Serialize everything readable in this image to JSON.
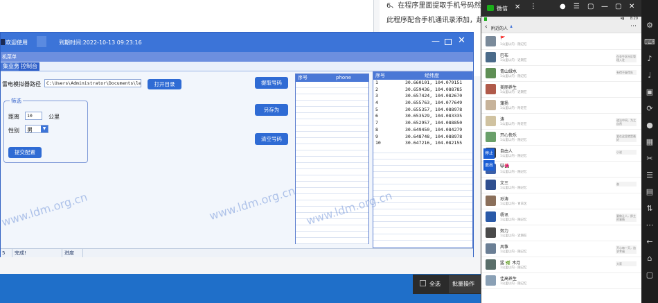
{
  "doc": {
    "line1": "6、在程序里面提取手机号码然后保存",
    "line2": "此程序配合手机通讯录添加，超"
  },
  "taskbar": {
    "select_all": "全选",
    "batch": "批量操作"
  },
  "app": {
    "title": "欢迎使用",
    "expire": "到期时间:2022-10-13 09:23:16",
    "menu": "机菜单",
    "tabs": [
      "集业务",
      "控制台"
    ],
    "path_label": "雷电模拟器路径",
    "path_value": "C:\\Users\\Administrator\\Documents\\leidi",
    "open_dir": "打开目录",
    "filter": {
      "legend": "筛选",
      "distance_label": "距离",
      "distance_value": "10",
      "distance_unit": "公里",
      "gender_label": "性别",
      "gender_value": "男",
      "submit": "提交配置"
    },
    "actions": {
      "extract": "提取号码",
      "save_as": "另存为",
      "clear": "清空号码"
    },
    "phone_grid": {
      "col_index": "序号",
      "col_phone": "phone"
    },
    "coord_grid": {
      "col_index": "序号",
      "col_coord": "经纬度",
      "rows": [
        {
          "n": "1",
          "v": "30.660101, 104.079151"
        },
        {
          "n": "2",
          "v": "30.659436, 104.088785"
        },
        {
          "n": "3",
          "v": "30.657424, 104.082670"
        },
        {
          "n": "4",
          "v": "30.655763, 104.077649"
        },
        {
          "n": "5",
          "v": "30.655357, 104.088978"
        },
        {
          "n": "6",
          "v": "30.653529, 104.083335"
        },
        {
          "n": "7",
          "v": "30.652957, 104.088850"
        },
        {
          "n": "8",
          "v": "30.649450, 104.084279"
        },
        {
          "n": "9",
          "v": "30.648748, 104.088978"
        },
        {
          "n": "10",
          "v": "30.647216, 104.082155"
        }
      ]
    },
    "status": {
      "left": "5",
      "done": "完成!",
      "progress": "进度"
    }
  },
  "watermarks": [
    "www.ldm.org.cn",
    "www.ldm.org.cn",
    "www.ldm.org.cn"
  ],
  "phone": {
    "app_name": "微信",
    "page_title": "附近的人",
    "time": "8:29",
    "stop": "停止",
    "quit": "退出",
    "people": [
      {
        "name": "🚩",
        "dist": "1公里以内 · 随记忆",
        "sig": "",
        "color": "#7a8a9a"
      },
      {
        "name": "巴布",
        "dist": "1公里以内 · 近期在",
        "sig": "在金牛区社区管理入驻",
        "color": "#4b6b8a"
      },
      {
        "name": "青山绿水",
        "dist": "1公里以内 · 随记忆",
        "sig": "有得不复得失",
        "color": "#5f8f55"
      },
      {
        "name": "美丽养生",
        "dist": "1公里以内 · 近期在",
        "sig": "",
        "color": "#b05a4a"
      },
      {
        "name": "蒲扬",
        "dist": "1公里以内 · 附近在",
        "sig": "",
        "color": "#c7b39a"
      },
      {
        "name": "涛",
        "dist": "1公里以内 · 附近在",
        "sig": "道法中间，为之自然",
        "color": "#d0c2a0"
      },
      {
        "name": "开心快乐",
        "dist": "1公里以内 · 随记忆",
        "sig": "爱在这里就是最好",
        "color": "#6aa06a"
      },
      {
        "name": "自由人",
        "dist": "1公里以内 · 随记忆",
        "sig": "小说",
        "color": "#3a3a3a"
      },
      {
        "name": "😺🌺",
        "dist": "1公里以内 · 随记忆",
        "sig": "",
        "color": "#3b5fa8"
      },
      {
        "name": "文三",
        "dist": "1公里以内 · 随记忆",
        "sig": "奋",
        "color": "#2f4f8f"
      },
      {
        "name": "孙涛",
        "dist": "1公里以内 · 青羊区",
        "sig": "",
        "color": "#8a6f5a"
      },
      {
        "name": "杨讯",
        "dist": "1公里以内 · 随记忆",
        "sig": "要做让人，即主的事情",
        "color": "#2a5aa8"
      },
      {
        "name": "努力",
        "dist": "1公里以内 · 近期在",
        "sig": "",
        "color": "#4a4a4a"
      },
      {
        "name": "风筝",
        "dist": "1公里以内 · 随记忆",
        "sig": "开心每一天，追求幸福",
        "color": "#6b7f95"
      },
      {
        "name": "猛 🌿 木月",
        "dist": "1公里以内 · 随记忆",
        "sig": "大家",
        "color": "#5a6f6a"
      },
      {
        "name": "佳高养生",
        "dist": "1公里以内 · 随记忆",
        "sig": "",
        "color": "#8aa0b5"
      }
    ]
  }
}
